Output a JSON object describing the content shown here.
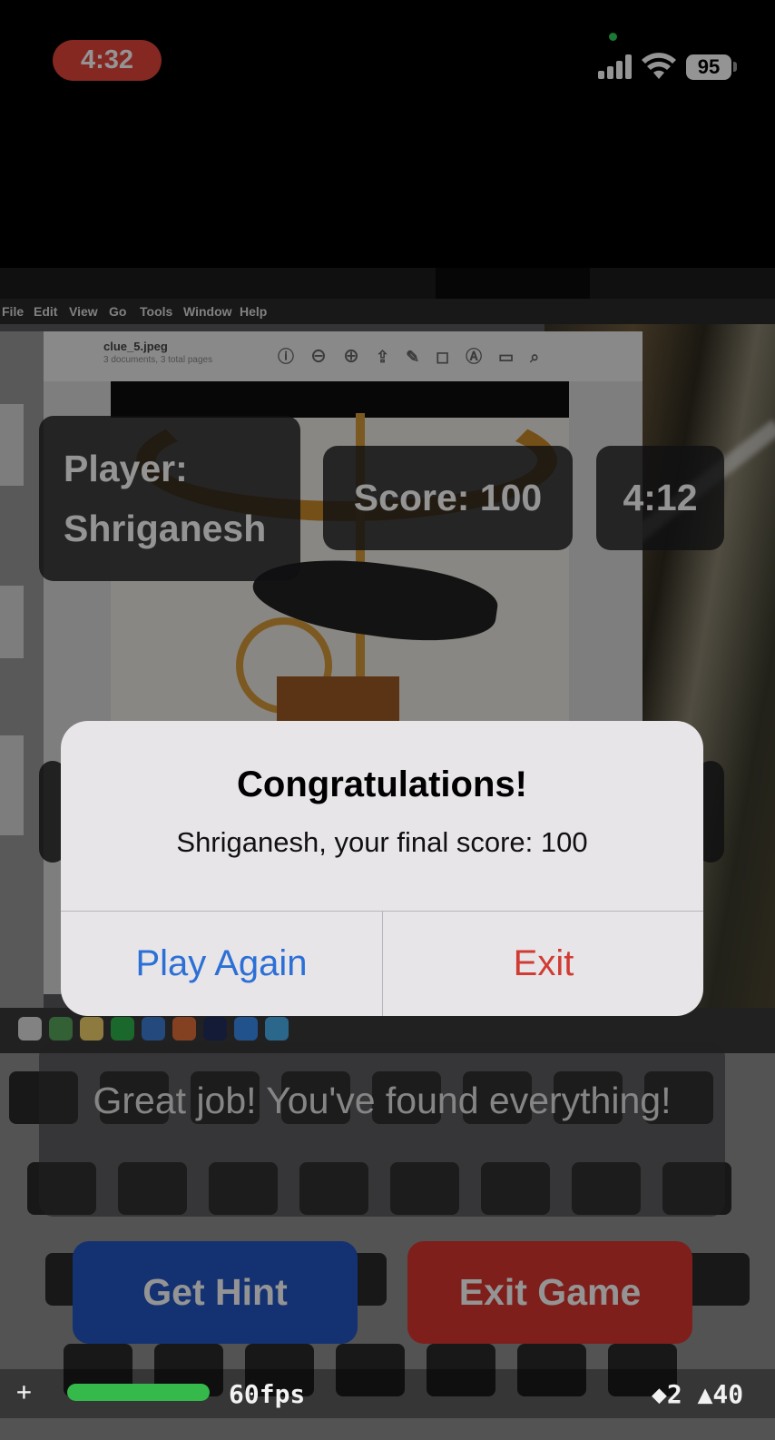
{
  "status_bar": {
    "time": "4:32",
    "battery": "95",
    "icons": [
      "signal-icon",
      "wifi-icon",
      "battery-icon"
    ]
  },
  "background_screen": {
    "menu_items": [
      "File",
      "Edit",
      "View",
      "Go",
      "Tools",
      "Window",
      "Help"
    ],
    "preview_title": "clue_5.jpeg",
    "preview_subtitle": "3 documents, 3 total pages"
  },
  "hud": {
    "player_label": "Player:",
    "player_name": "Shriganesh",
    "score": "Score: 100",
    "timer": "4:12"
  },
  "message": "Great job! You've found everything!",
  "buttons": {
    "hint": "Get Hint",
    "exit_game": "Exit Game"
  },
  "alert": {
    "title": "Congratulations!",
    "message": "Shriganesh, your final score: 100",
    "primary": "Play Again",
    "secondary": "Exit"
  },
  "debug": {
    "plus": "+",
    "fps": "60fps",
    "stats": "◆2 ▲40"
  },
  "colors": {
    "time_pill": "#e5453b",
    "hint_button": "#2456c4",
    "exit_button": "#d9362f",
    "alert_blue": "#2c70d6",
    "alert_red": "#d03c33"
  }
}
